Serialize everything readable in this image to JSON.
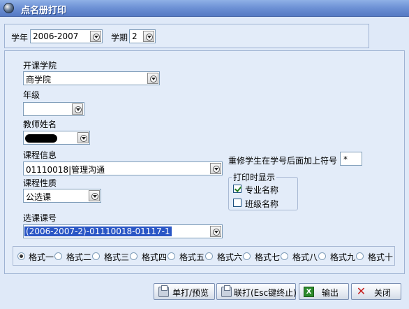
{
  "window": {
    "title": "点名册打印"
  },
  "term": {
    "year_label": "学年",
    "year_value": "2006-2007",
    "semester_label": "学期",
    "semester_value": "2"
  },
  "form": {
    "college_label": "开课学院",
    "college_value": "商学院",
    "grade_label": "年级",
    "grade_value": "",
    "teacher_label": "教师姓名",
    "course_info_label": "课程信息",
    "course_info_value": "01110018|管理沟通",
    "course_nature_label": "课程性质",
    "course_nature_value": "公选课",
    "course_code_label": "选课课号",
    "course_code_value": "(2006-2007-2)-01110018-01117-1"
  },
  "retake": {
    "label": "重修学生在学号后面加上符号",
    "symbol": "*"
  },
  "print_display": {
    "legend": "打印时显示",
    "major_label": "专业名称",
    "major_checked": true,
    "class_label": "班级名称",
    "class_checked": false
  },
  "formats": {
    "selected": "格式一",
    "options": [
      "格式一",
      "格式二",
      "格式三",
      "格式四",
      "格式五",
      "格式六",
      "格式七",
      "格式八",
      "格式九",
      "格式十"
    ]
  },
  "buttons": {
    "single_print": "单打/预览",
    "batch_print": "联打(Esc键终止)",
    "export": "输出",
    "close": "关闭"
  }
}
